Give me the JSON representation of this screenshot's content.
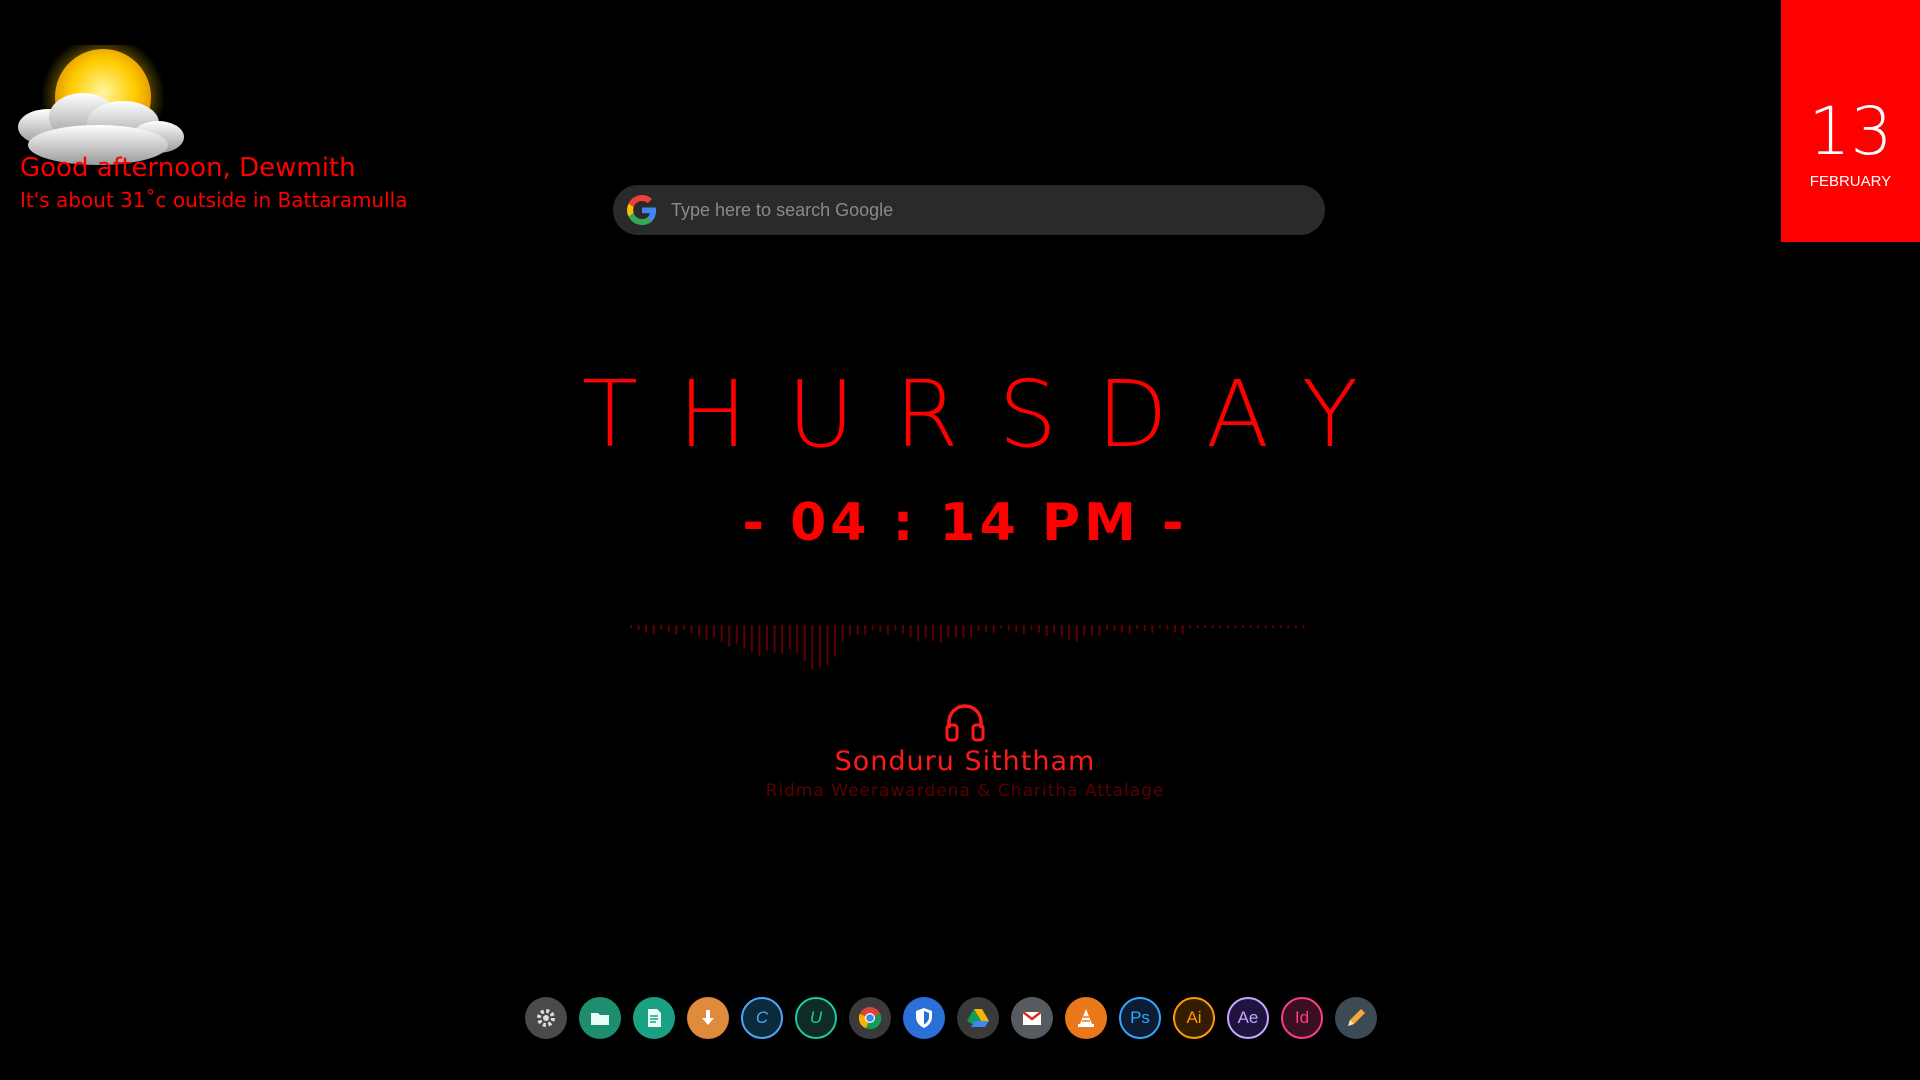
{
  "weather": {
    "greeting": "Good afternoon, Dewmith",
    "summary": "It's about 31˚c outside in Battaramulla",
    "icon": "partly-cloudy-icon"
  },
  "search": {
    "placeholder": "Type here to search Google",
    "icon": "google-icon"
  },
  "date": {
    "day": "13",
    "month": "FEBRUARY",
    "tile_color": "#ff0000"
  },
  "clock": {
    "weekday": "THURSDAY",
    "time": "- 04 : 14 PM -"
  },
  "now_playing": {
    "icon": "headphones-icon",
    "title": "Sonduru Siththam",
    "artist": "Ridma Weerawardena & Charitha Attalage"
  },
  "dock": {
    "items": [
      {
        "name": "settings",
        "icon": "gear-icon",
        "label": "",
        "color": "#4a4a4a"
      },
      {
        "name": "files",
        "icon": "folder-icon",
        "label": "",
        "color": "#1e8c6e"
      },
      {
        "name": "notes",
        "icon": "document-icon",
        "label": "",
        "color": "#1aa184"
      },
      {
        "name": "downloader",
        "icon": "download-icon",
        "label": "",
        "color": "#e08a3c"
      },
      {
        "name": "ccleaner",
        "icon": "c-icon",
        "label": "C",
        "color": "#0d2a3d",
        "fg": "#4aa8ff"
      },
      {
        "name": "upwork",
        "icon": "u-icon",
        "label": "U",
        "color": "#0f2b25",
        "fg": "#1fc8a0"
      },
      {
        "name": "chrome",
        "icon": "chrome-icon",
        "label": "",
        "color": "#3a3a3a"
      },
      {
        "name": "security",
        "icon": "shield-icon",
        "label": "",
        "color": "#2b6fd8"
      },
      {
        "name": "drive",
        "icon": "drive-icon",
        "label": "",
        "color": "#3a3a3a"
      },
      {
        "name": "gmail",
        "icon": "mail-icon",
        "label": "",
        "color": "#555b60"
      },
      {
        "name": "vlc",
        "icon": "cone-icon",
        "label": "",
        "color": "#e8781a"
      },
      {
        "name": "photoshop",
        "icon": "ps-icon",
        "label": "Ps",
        "color": "#0b1c33",
        "fg": "#31a8ff"
      },
      {
        "name": "illustrator",
        "icon": "ai-icon",
        "label": "Ai",
        "color": "#331c00",
        "fg": "#ff9a00"
      },
      {
        "name": "after-effects",
        "icon": "ae-icon",
        "label": "Ae",
        "color": "#1f1440",
        "fg": "#c9a4ff"
      },
      {
        "name": "indesign",
        "icon": "id-icon",
        "label": "Id",
        "color": "#3a0f22",
        "fg": "#ff3b8d"
      },
      {
        "name": "editor",
        "icon": "pencil-icon",
        "label": "",
        "color": "#3c4a55"
      }
    ]
  }
}
